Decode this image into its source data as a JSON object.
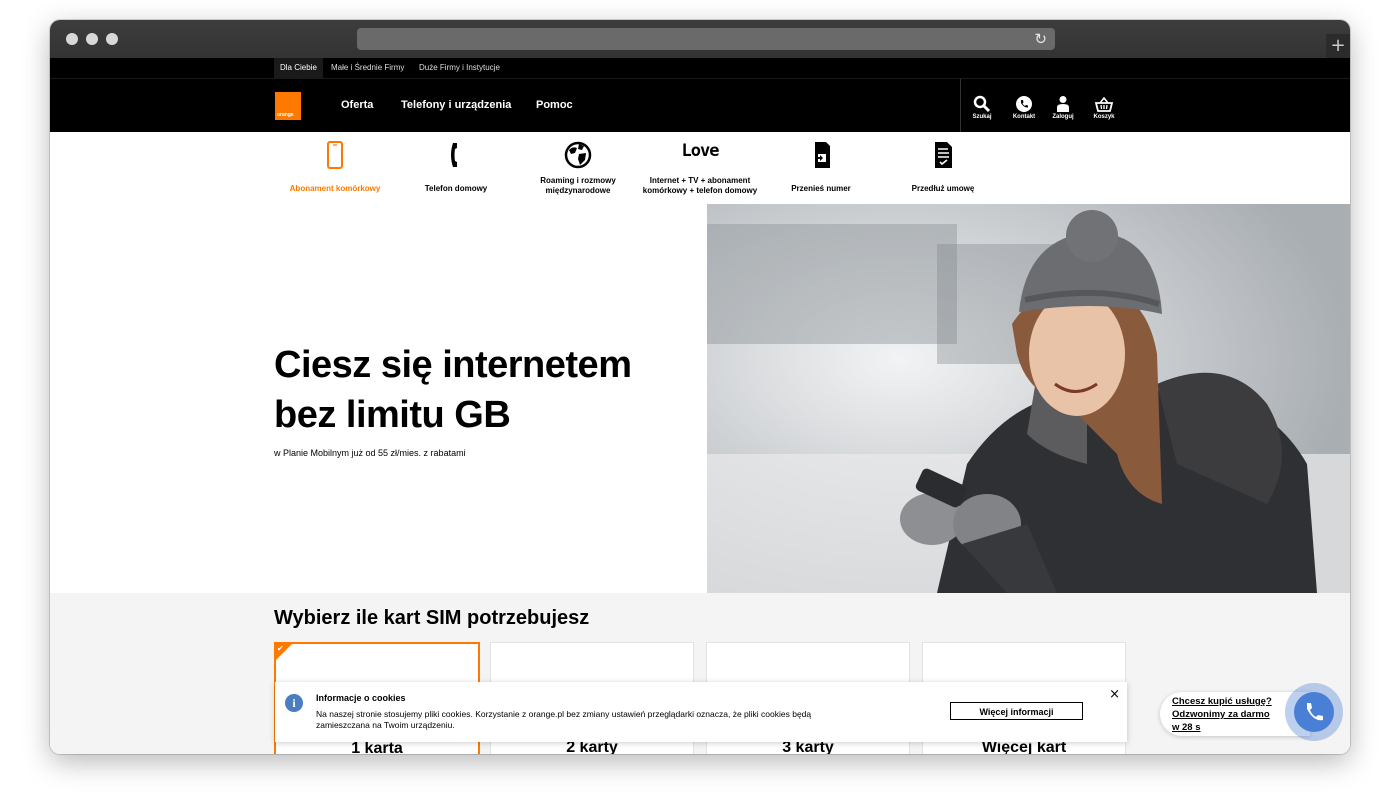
{
  "segments": [
    "Dla Ciebie",
    "Małe i Średnie Firmy",
    "Duże Firmy i Instytucje"
  ],
  "brand": {
    "logo_text": "orange",
    "color": "#ff7900"
  },
  "nav": {
    "links": [
      "Oferta",
      "Telefony i urządzenia",
      "Pomoc"
    ],
    "icons": [
      {
        "name": "search-icon",
        "label": "Szukaj"
      },
      {
        "name": "phone-icon",
        "label": "Kontakt"
      },
      {
        "name": "user-icon",
        "label": "Zaloguj"
      },
      {
        "name": "basket-icon",
        "label": "Koszyk"
      }
    ]
  },
  "categories": [
    {
      "name": "mobile-phone-icon",
      "label": "Abonament komórkowy",
      "active": true
    },
    {
      "name": "handset-icon",
      "label": "Telefon domowy"
    },
    {
      "name": "globe-icon",
      "label": "Roaming i rozmowy międzynarodowe"
    },
    {
      "name": "love-icon",
      "icon_text": "Love",
      "label": "Internet + TV + abonament komórkowy + telefon domowy"
    },
    {
      "name": "sim-transfer-icon",
      "label": "Przenieś numer"
    },
    {
      "name": "document-icon",
      "label": "Przedłuż umowę"
    }
  ],
  "hero": {
    "title_line1": "Ciesz się internetem",
    "title_line2": "bez limitu GB",
    "subtitle": "w Planie Mobilnym już od 55 zł/mies. z rabatami"
  },
  "sim": {
    "title": "Wybierz ile kart SIM potrzebujesz",
    "options": [
      "1 karta",
      "2 karty",
      "3 karty",
      "Więcej kart"
    ],
    "selected_index": 0
  },
  "cookie": {
    "title": "Informacje o cookies",
    "text": "Na naszej stronie stosujemy pliki cookies. Korzystanie z orange.pl bez zmiany ustawień przeglądarki oznacza, że pliki cookies będą zamieszczana na Twoim urządzeniu.",
    "button": "Więcej informacji",
    "close": "×"
  },
  "callback": {
    "line1": "Chcesz kupić usługę?",
    "line2": "Odzwonimy za darmo",
    "line3": "w 28 s"
  }
}
